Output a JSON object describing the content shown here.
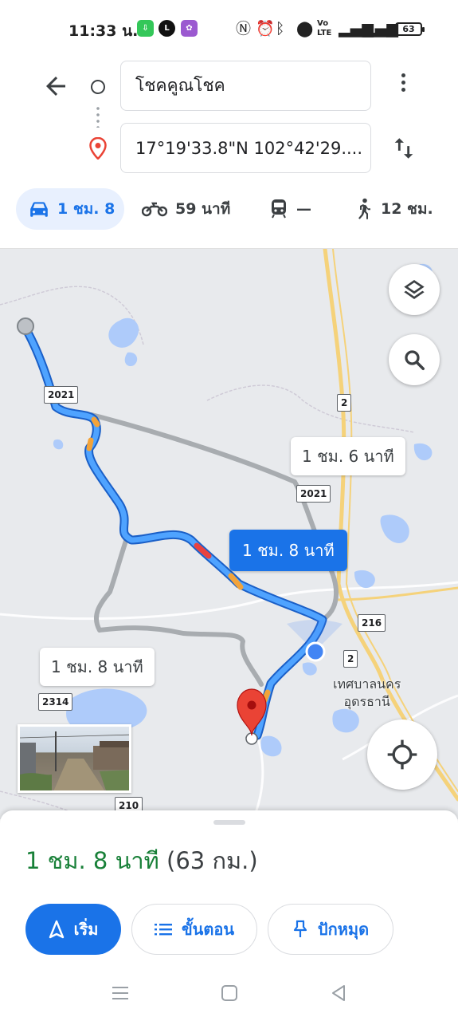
{
  "status_bar": {
    "time": "11:33 น.",
    "battery": "63"
  },
  "directions": {
    "origin": "โชคคูณโชค",
    "destination": "17°19'33.8\"N 102°42'29...."
  },
  "modes": [
    {
      "name": "car",
      "label": "1 ชม. 8"
    },
    {
      "name": "motorbike",
      "label": "59 นาที"
    },
    {
      "name": "transit",
      "label": "—"
    },
    {
      "name": "walk",
      "label": "12 ชม."
    }
  ],
  "map": {
    "route_labels": {
      "alt1": "1 ชม. 6 นาที",
      "main": "1 ชม. 8 นาที",
      "alt2": "1 ชม. 8 นาที"
    },
    "road_numbers": [
      "2021",
      "2021",
      "2",
      "216",
      "2",
      "2314",
      "210"
    ],
    "city": {
      "line1": "เทศบาลนคร",
      "line2": "อุดรธานี"
    }
  },
  "sheet": {
    "duration": "1 ชม. 8 นาที",
    "distance": "(63 กม.)",
    "start_label": "เริ่ม",
    "steps_label": "ขั้นตอน",
    "pin_label": "ปักหมุด"
  },
  "colors": {
    "accent": "#1a73e8",
    "duration_green": "#188038",
    "route_blue": "#4285f4",
    "route_gray": "#a8acb0",
    "water": "#aecbfa",
    "pin_red": "#ea4335"
  }
}
